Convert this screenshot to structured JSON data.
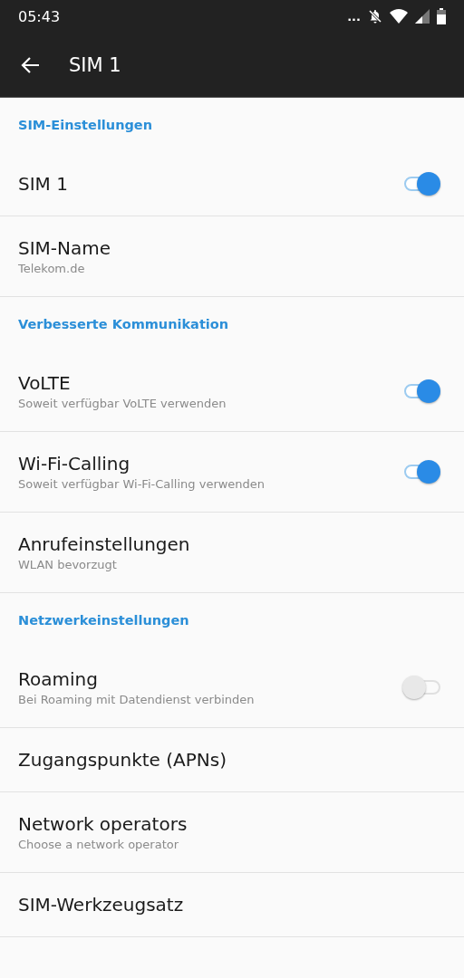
{
  "status_bar": {
    "time": "05:43",
    "overflow": "..."
  },
  "app_bar": {
    "title": "SIM 1"
  },
  "list": [
    {
      "kind": "header",
      "title": "SIM-Einstellungen"
    },
    {
      "kind": "switch",
      "title": "SIM 1",
      "on": true
    },
    {
      "kind": "item",
      "title": "SIM-Name",
      "summary": "Telekom.de"
    },
    {
      "kind": "header",
      "title": "Verbesserte Kommunikation"
    },
    {
      "kind": "switch",
      "title": "VoLTE",
      "summary": "Soweit verfügbar VoLTE verwenden",
      "on": true
    },
    {
      "kind": "switch",
      "title": "Wi-Fi-Calling",
      "summary": "Soweit verfügbar Wi-Fi-Calling verwenden",
      "on": true
    },
    {
      "kind": "item",
      "title": "Anrufeinstellungen",
      "summary": "WLAN bevorzugt"
    },
    {
      "kind": "header",
      "title": "Netzwerkeinstellungen"
    },
    {
      "kind": "switch",
      "title": "Roaming",
      "summary": "Bei Roaming mit Datendienst verbinden",
      "on": false
    },
    {
      "kind": "item",
      "title": "Zugangspunkte (APNs)"
    },
    {
      "kind": "item",
      "title": "Network operators",
      "summary": "Choose a network operator"
    },
    {
      "kind": "item",
      "title": "SIM-Werkzeugsatz"
    }
  ]
}
